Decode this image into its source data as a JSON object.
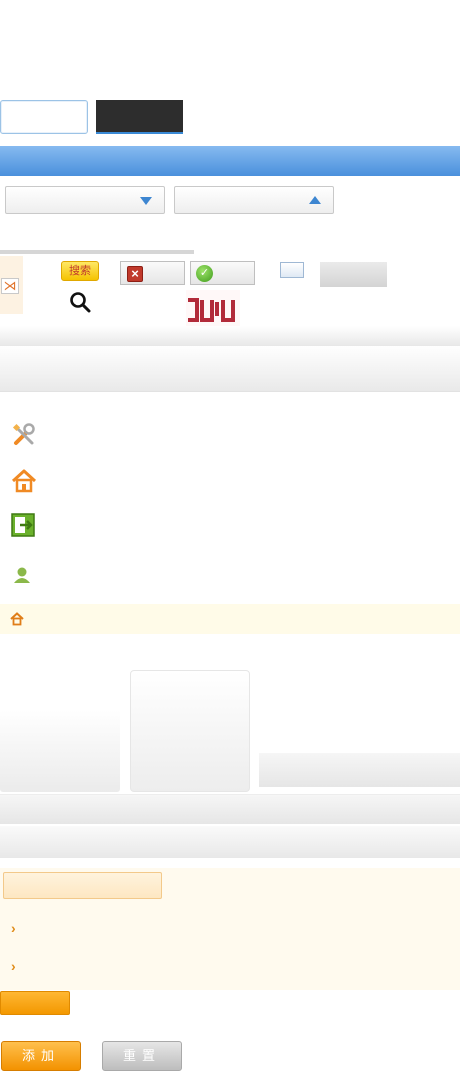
{
  "toolbar": {
    "search_label": "搜索",
    "glyph_text": "ᑐᑌᑊ"
  },
  "buttons": {
    "add_label": "添加",
    "reset_label": "重置"
  },
  "icons": {
    "tools": "tools-icon",
    "home": "home-icon",
    "exit": "exit-icon",
    "user": "user-icon",
    "breadcrumb_home": "home-icon",
    "search": "magnifier-icon",
    "close": "close-icon",
    "ok": "check-icon"
  },
  "colors": {
    "accent_blue": "#4a90dc",
    "accent_orange": "#f39200",
    "crumb_bg": "#fffbe8"
  }
}
